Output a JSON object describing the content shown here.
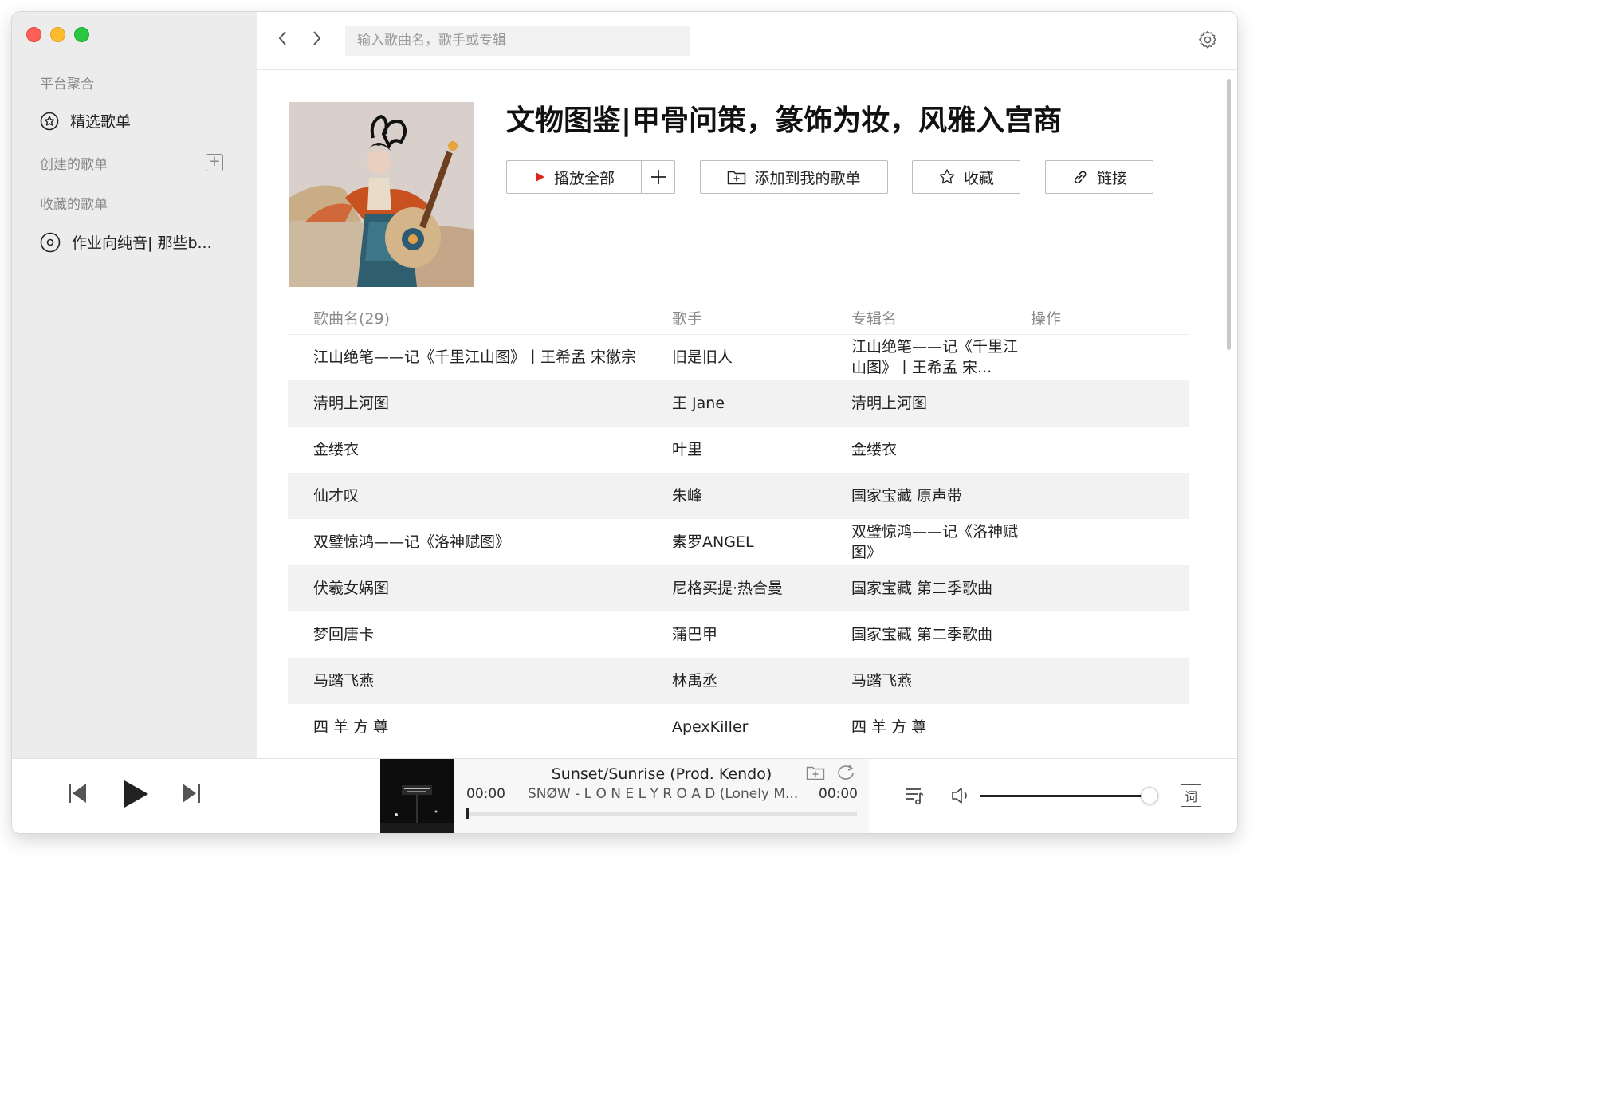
{
  "sidebar": {
    "section_platform": "平台聚合",
    "featured_label": "精选歌单",
    "section_created": "创建的歌单",
    "section_collected": "收藏的歌单",
    "collected_item": "作业向纯音| 那些b..."
  },
  "topbar": {
    "search_placeholder": "输入歌曲名，歌手或专辑"
  },
  "playlist": {
    "title": "文物图鉴|甲骨问策，篆饰为妆，风雅入宫商",
    "play_all_label": "播放全部",
    "add_to_mine_label": "添加到我的歌单",
    "favorite_label": "收藏",
    "link_label": "链接"
  },
  "table": {
    "headers": [
      "歌曲名(29)",
      "歌手",
      "专辑名",
      "操作"
    ],
    "rows": [
      {
        "title": "江山绝笔——记《千里江山图》丨王希孟 宋徽宗",
        "artist": "旧是旧人",
        "album": "江山绝笔——记《千里江山图》丨王希孟 宋..."
      },
      {
        "title": "清明上河图",
        "artist": "王 Jane",
        "album": "清明上河图"
      },
      {
        "title": "金缕衣",
        "artist": "叶里",
        "album": "金缕衣"
      },
      {
        "title": "仙才叹",
        "artist": "朱峰",
        "album": "国家宝藏 原声带"
      },
      {
        "title": "双璧惊鸿——记《洛神赋图》",
        "artist": "素罗ANGEL",
        "album": "双璧惊鸿——记《洛神赋图》"
      },
      {
        "title": "伏羲女娲图",
        "artist": "尼格买提·热合曼",
        "album": "国家宝藏 第二季歌曲"
      },
      {
        "title": "梦回唐卡",
        "artist": "蒲巴甲",
        "album": "国家宝藏 第二季歌曲"
      },
      {
        "title": "马踏飞燕",
        "artist": "林禹丞",
        "album": "马踏飞燕"
      },
      {
        "title": "四 羊 方 尊",
        "artist": "ApexKiller",
        "album": "四 羊 方 尊"
      }
    ]
  },
  "player": {
    "track_title": "Sunset/Sunrise (Prod. Kendo)",
    "track_artist": "SNØW - L O N E L Y R O A D (Lonely M...",
    "time_elapsed": "00:00",
    "time_total": "00:00",
    "progress_fraction": 0.0,
    "volume_fraction": 0.95,
    "lyric_label": "词"
  }
}
